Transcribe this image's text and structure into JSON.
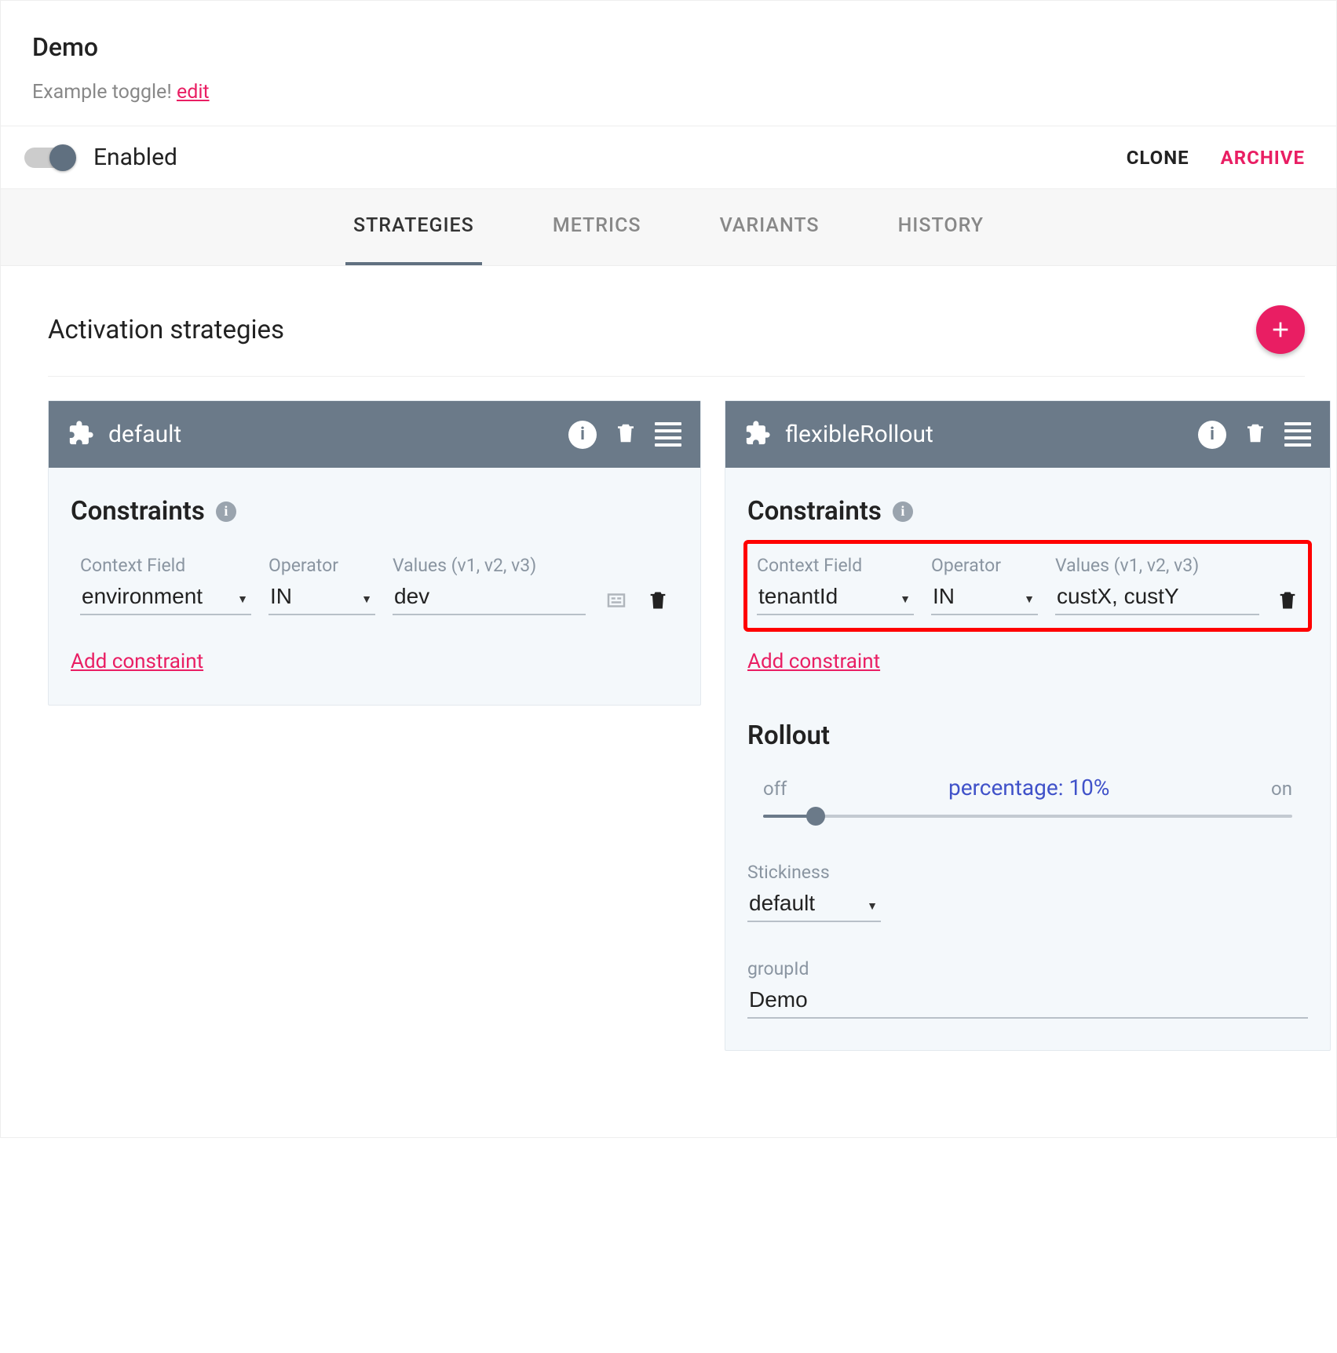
{
  "header": {
    "title": "Demo",
    "subtitle": "Example toggle!",
    "edit": "edit"
  },
  "toolbar": {
    "enabled_label": "Enabled",
    "clone": "CLONE",
    "archive": "ARCHIVE"
  },
  "tabs": {
    "strategies": "STRATEGIES",
    "metrics": "METRICS",
    "variants": "VARIANTS",
    "history": "HISTORY"
  },
  "section": {
    "activation_title": "Activation strategies"
  },
  "labels": {
    "constraints": "Constraints",
    "context_field": "Context Field",
    "operator": "Operator",
    "values": "Values (v1, v2, v3)",
    "add_constraint": "Add constraint",
    "rollout": "Rollout",
    "off": "off",
    "on": "on",
    "stickiness": "Stickiness",
    "groupId": "groupId"
  },
  "cards": {
    "default": {
      "name": "default",
      "context": "environment",
      "operator": "IN",
      "values": "dev"
    },
    "flex": {
      "name": "flexibleRollout",
      "context": "tenantId",
      "operator": "IN",
      "values": "custX, custY",
      "rollout": {
        "percent_label": "percentage: 10%",
        "percent_value": 10,
        "stickiness": "default",
        "groupId": "Demo"
      }
    }
  }
}
